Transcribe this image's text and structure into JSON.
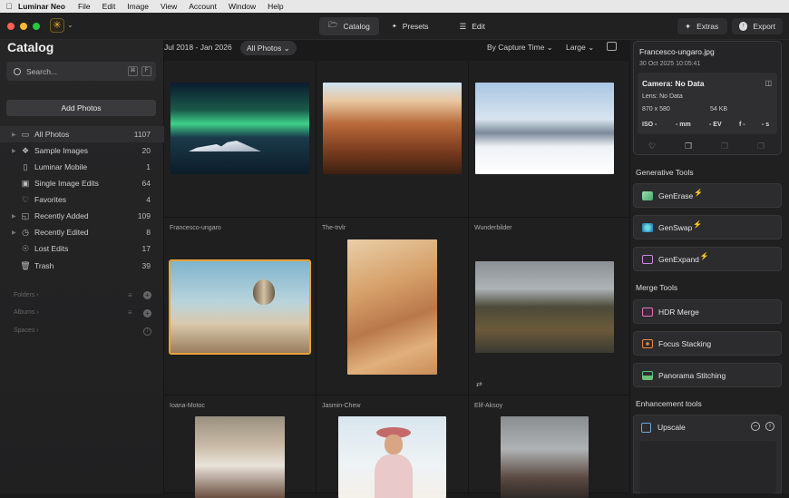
{
  "menubar": {
    "app_name": "Luminar Neo",
    "items": [
      "File",
      "Edit",
      "Image",
      "View",
      "Account",
      "Window",
      "Help"
    ]
  },
  "topnav": {
    "tabs": [
      {
        "label": "Catalog"
      },
      {
        "label": "Presets"
      },
      {
        "label": "Edit"
      }
    ],
    "extras_label": "Extras",
    "export_label": "Export"
  },
  "sidebar": {
    "title": "Catalog",
    "search_placeholder": "Search...",
    "search_keys": [
      "⌘",
      "F"
    ],
    "add_photos_label": "Add Photos",
    "items": [
      {
        "label": "All Photos",
        "count": "1107",
        "icon": "album-icon"
      },
      {
        "label": "Sample Images",
        "count": "20",
        "icon": "sample-images-icon"
      },
      {
        "label": "Luminar Mobile",
        "count": "1",
        "icon": "phone-icon"
      },
      {
        "label": "Single Image Edits",
        "count": "64",
        "icon": "image-edit-icon"
      },
      {
        "label": "Favorites",
        "count": "4",
        "icon": "heart-icon"
      },
      {
        "label": "Recently Added",
        "count": "109",
        "icon": "recently-added-icon"
      },
      {
        "label": "Recently Edited",
        "count": "8",
        "icon": "recently-edited-icon"
      },
      {
        "label": "Lost Edits",
        "count": "17",
        "icon": "lost-edits-icon"
      },
      {
        "label": "Trash",
        "count": "39",
        "icon": "trash-icon"
      }
    ],
    "sections": [
      {
        "label": "Folders"
      },
      {
        "label": "Albums"
      },
      {
        "label": "Spaces"
      }
    ]
  },
  "main": {
    "date_range": "Jul 2018 - Jan 2026",
    "filter": "All Photos",
    "sort": "By Capture Time",
    "size": "Large",
    "photo_names": [
      "Francesco-ungaro",
      "The-trvlr",
      "Wunderbilder",
      "Ioana-Motoc",
      "Jasmin-Chew",
      "Elif-Aksoy"
    ]
  },
  "info": {
    "file_name": "Francesco-ungaro.jpg",
    "date": "30 Oct 2025 10:05:41",
    "camera": "Camera: No Data",
    "lens": "Lens: No Data",
    "dimensions": "870 x 580",
    "file_size": "54 KB",
    "iso": "ISO -",
    "focal": "- mm",
    "ev": "- EV",
    "aperture": "f -",
    "shutter": "- s"
  },
  "tools": {
    "generative_header": "Generative Tools",
    "generative": [
      {
        "label": "GenErase"
      },
      {
        "label": "GenSwap"
      },
      {
        "label": "GenExpand"
      }
    ],
    "merge_header": "Merge Tools",
    "merge": [
      {
        "label": "HDR Merge"
      },
      {
        "label": "Focus Stacking"
      },
      {
        "label": "Panorama Stitching"
      }
    ],
    "enhancement_header": "Enhancement tools",
    "upscale_label": "Upscale"
  },
  "colors": {
    "accent": "#e8a43a",
    "generative_bolt": "#e38bd6"
  }
}
